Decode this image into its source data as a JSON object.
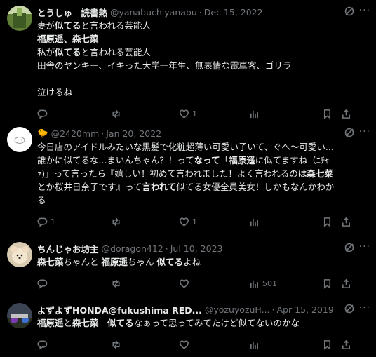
{
  "tweets": [
    {
      "name": "とうしゅ　読書熱",
      "handle": "@yanabuchiyanabu",
      "dot": "·",
      "date": "Dec 15, 2022",
      "lines": [
        {
          "segs": [
            {
              "t": "妻が"
            },
            {
              "t": "似てる",
              "b": true
            },
            {
              "t": "と言われる芸能人"
            }
          ]
        },
        {
          "segs": [
            {
              "t": "福原遥、森七菜",
              "b": true
            }
          ]
        },
        {
          "segs": [
            {
              "t": "私が"
            },
            {
              "t": "似てる",
              "b": true
            },
            {
              "t": "と言われる芸能人"
            }
          ]
        },
        {
          "segs": [
            {
              "t": "田舎のヤンキー、イキった大学一年生、無表情な電車客、ゴリラ"
            }
          ]
        },
        {
          "segs": [
            {
              "t": " "
            }
          ]
        },
        {
          "segs": [
            {
              "t": "泣けるね"
            }
          ]
        }
      ],
      "reply": "",
      "retweet": "",
      "like": "1",
      "views": ""
    },
    {
      "name": "🐤",
      "handle": "@2420mm",
      "dot": "·",
      "date": "Jan 20, 2022",
      "lines": [
        {
          "segs": [
            {
              "t": "今日店のアイドルみたいな黒髪で化粧超薄い可愛い子いて、ぐへ〜可愛い..."
            }
          ]
        },
        {
          "segs": [
            {
              "t": "誰かに似てるな...まいんちゃん？！って"
            },
            {
              "t": "なって",
              "b": true
            },
            {
              "t": "「"
            },
            {
              "t": "福原遥",
              "b": true
            },
            {
              "t": "に似てますね（ﾆﾁｬ"
            }
          ]
        },
        {
          "segs": [
            {
              "t": "ｧ)」って言ったら『嬉しい！初めて言われました！よく言われるの"
            },
            {
              "t": "は森七菜",
              "b": true
            }
          ]
        },
        {
          "segs": [
            {
              "t": "とか桜井日奈子です』って"
            },
            {
              "t": "言われて",
              "b": true
            },
            {
              "t": "似てる女優全員美女！しかもなんかわか"
            }
          ]
        },
        {
          "segs": [
            {
              "t": "る"
            }
          ]
        }
      ],
      "reply": "1",
      "retweet": "",
      "like": "1",
      "views": ""
    },
    {
      "name": "ちんじゃお坊主",
      "handle": "@doragon412",
      "dot": "·",
      "date": "Jul 10, 2023",
      "lines": [
        {
          "segs": [
            {
              "t": "森七菜",
              "b": true
            },
            {
              "t": "ちゃんと "
            },
            {
              "t": "福原遥",
              "b": true
            },
            {
              "t": "ちゃん "
            },
            {
              "t": "似てる",
              "b": true
            },
            {
              "t": "よね"
            }
          ]
        }
      ],
      "reply": "",
      "retweet": "",
      "like": "",
      "views": "501"
    },
    {
      "name": "よずよずHONDA@fukushima RED...",
      "handle": "@yozuyozuH...",
      "dot": "·",
      "date": "Apr 15, 2019",
      "lines": [
        {
          "segs": [
            {
              "t": "福原遥",
              "b": true
            },
            {
              "t": "と"
            },
            {
              "t": "森七菜",
              "b": true
            },
            {
              "t": "　"
            },
            {
              "t": "似てる",
              "b": true
            },
            {
              "t": "なぁって思ってみてたけど似てないのかな"
            }
          ]
        }
      ],
      "reply": "",
      "retweet": "",
      "like": "",
      "views": ""
    }
  ],
  "icons": {
    "reply": "reply-icon",
    "retweet": "retweet-icon",
    "like": "heart-icon",
    "views": "views-icon",
    "bookmark": "bookmark-icon",
    "share": "share-icon",
    "grok": "grok-icon",
    "more": "more-icon"
  },
  "more_label": "···",
  "colors": {
    "background": "#000000",
    "text": "#e7e9ea",
    "muted": "#71767b",
    "divider": "#2f3336"
  }
}
